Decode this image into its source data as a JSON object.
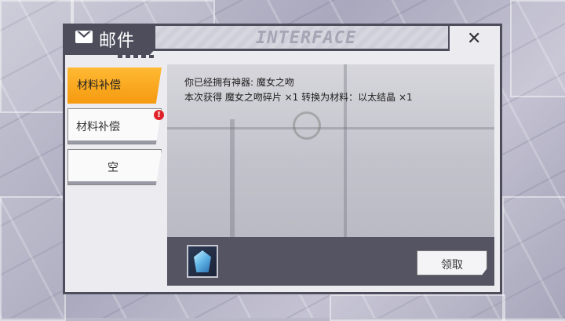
{
  "window": {
    "title": "邮件",
    "header_decoration": "INTERFACE",
    "close_icon": "close-icon",
    "mail_icon": "mail-icon"
  },
  "sidebar": {
    "tabs": [
      {
        "label": "材料补偿",
        "state": "active",
        "badge": ""
      },
      {
        "label": "材料补偿",
        "state": "normal",
        "badge": "!"
      },
      {
        "label": "空",
        "state": "normal",
        "badge": ""
      }
    ]
  },
  "mail": {
    "line1": "你已经拥有神器: 魔女之吻",
    "line2": "本次获得 魔女之吻碎片 ×1 转换为材料：以太结晶 ×1",
    "attachment_icon": "ether-crystal-icon",
    "claim_label": "领取"
  },
  "colors": {
    "active_tab": "#f5a623",
    "frame": "#4d4d5c",
    "badge": "#e0232b",
    "attach_bar": "#545462"
  }
}
